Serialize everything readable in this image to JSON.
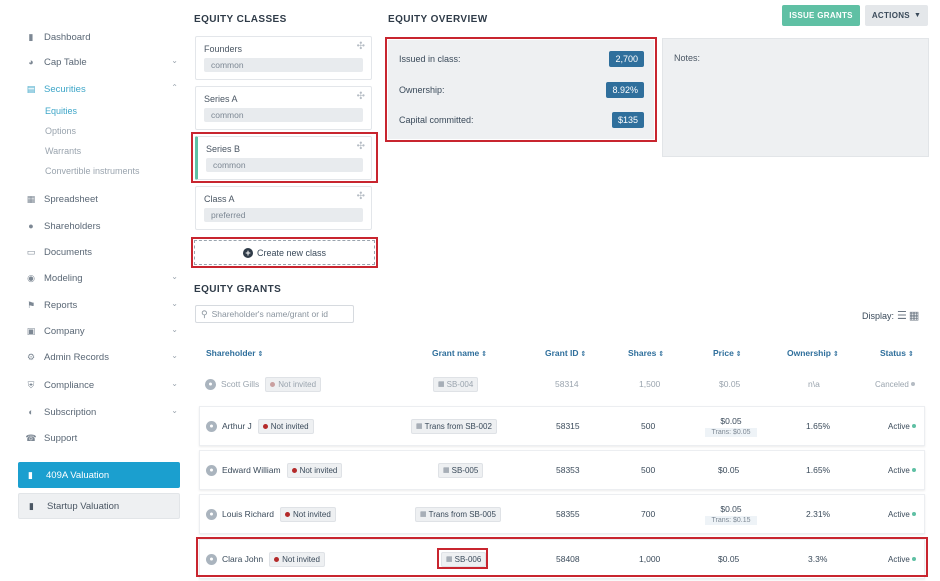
{
  "sidebar": {
    "items": [
      {
        "label": "Dashboard",
        "icon": "dashboard-icon"
      },
      {
        "label": "Cap Table",
        "icon": "pie-chart-icon"
      },
      {
        "label": "Securities",
        "icon": "securities-icon"
      },
      {
        "label": "Spreadsheet",
        "icon": "spreadsheet-icon"
      },
      {
        "label": "Shareholders",
        "icon": "user-icon"
      },
      {
        "label": "Documents",
        "icon": "folder-icon"
      },
      {
        "label": "Modeling",
        "icon": "lightbulb-icon"
      },
      {
        "label": "Reports",
        "icon": "flag-icon"
      },
      {
        "label": "Company",
        "icon": "building-icon"
      },
      {
        "label": "Admin Records",
        "icon": "admin-icon"
      },
      {
        "label": "Compliance",
        "icon": "shield-icon"
      },
      {
        "label": "Subscription",
        "icon": "subscription-icon"
      },
      {
        "label": "Support",
        "icon": "support-icon"
      }
    ],
    "securities_sub": [
      "Equities",
      "Options",
      "Warrants",
      "Convertible instruments"
    ],
    "valuation_button": "409A Valuation",
    "startup_button": "Startup Valuation"
  },
  "classes": {
    "title": "EQUITY CLASSES",
    "items": [
      {
        "name": "Founders",
        "type": "common"
      },
      {
        "name": "Series A",
        "type": "common"
      },
      {
        "name": "Series B",
        "type": "common"
      },
      {
        "name": "Class A",
        "type": "preferred"
      }
    ],
    "create_label": "Create new class"
  },
  "overview": {
    "title": "EQUITY OVERVIEW",
    "issued_label": "Issued in class:",
    "issued_value": "2,700",
    "ownership_label": "Ownership:",
    "ownership_value": "8.92%",
    "capital_label": "Capital committed:",
    "capital_value": "$135",
    "notes_label": "Notes:"
  },
  "toolbar": {
    "issue_label": "ISSUE GRANTS",
    "actions_label": "ACTIONS"
  },
  "grants": {
    "title": "EQUITY GRANTS",
    "search_placeholder": "Shareholder's name/grant or id",
    "display_label": "Display:",
    "columns": [
      "Shareholder",
      "Grant name",
      "Grant ID",
      "Shares",
      "Price",
      "Ownership",
      "Status"
    ],
    "rows": [
      {
        "name": "Scott Gills",
        "invite": "Not invited",
        "grant": "SB-004",
        "id": "58314",
        "shares": "1,500",
        "price": "$0.05",
        "price_sub": "",
        "ownership": "n\\a",
        "status": "Canceled"
      },
      {
        "name": "Arthur J",
        "invite": "Not invited",
        "grant": "Trans from SB-002",
        "id": "58315",
        "shares": "500",
        "price": "$0.05",
        "price_sub": "Trans: $0.05",
        "ownership": "1.65%",
        "status": "Active"
      },
      {
        "name": "Edward William",
        "invite": "Not invited",
        "grant": "SB-005",
        "id": "58353",
        "shares": "500",
        "price": "$0.05",
        "price_sub": "",
        "ownership": "1.65%",
        "status": "Active"
      },
      {
        "name": "Louis Richard",
        "invite": "Not invited",
        "grant": "Trans from SB-005",
        "id": "58355",
        "shares": "700",
        "price": "$0.05",
        "price_sub": "Trans: $0.15",
        "ownership": "2.31%",
        "status": "Active"
      },
      {
        "name": "Clara John",
        "invite": "Not invited",
        "grant": "SB-006",
        "id": "58408",
        "shares": "1,000",
        "price": "$0.05",
        "price_sub": "",
        "ownership": "3.3%",
        "status": "Active"
      }
    ]
  }
}
